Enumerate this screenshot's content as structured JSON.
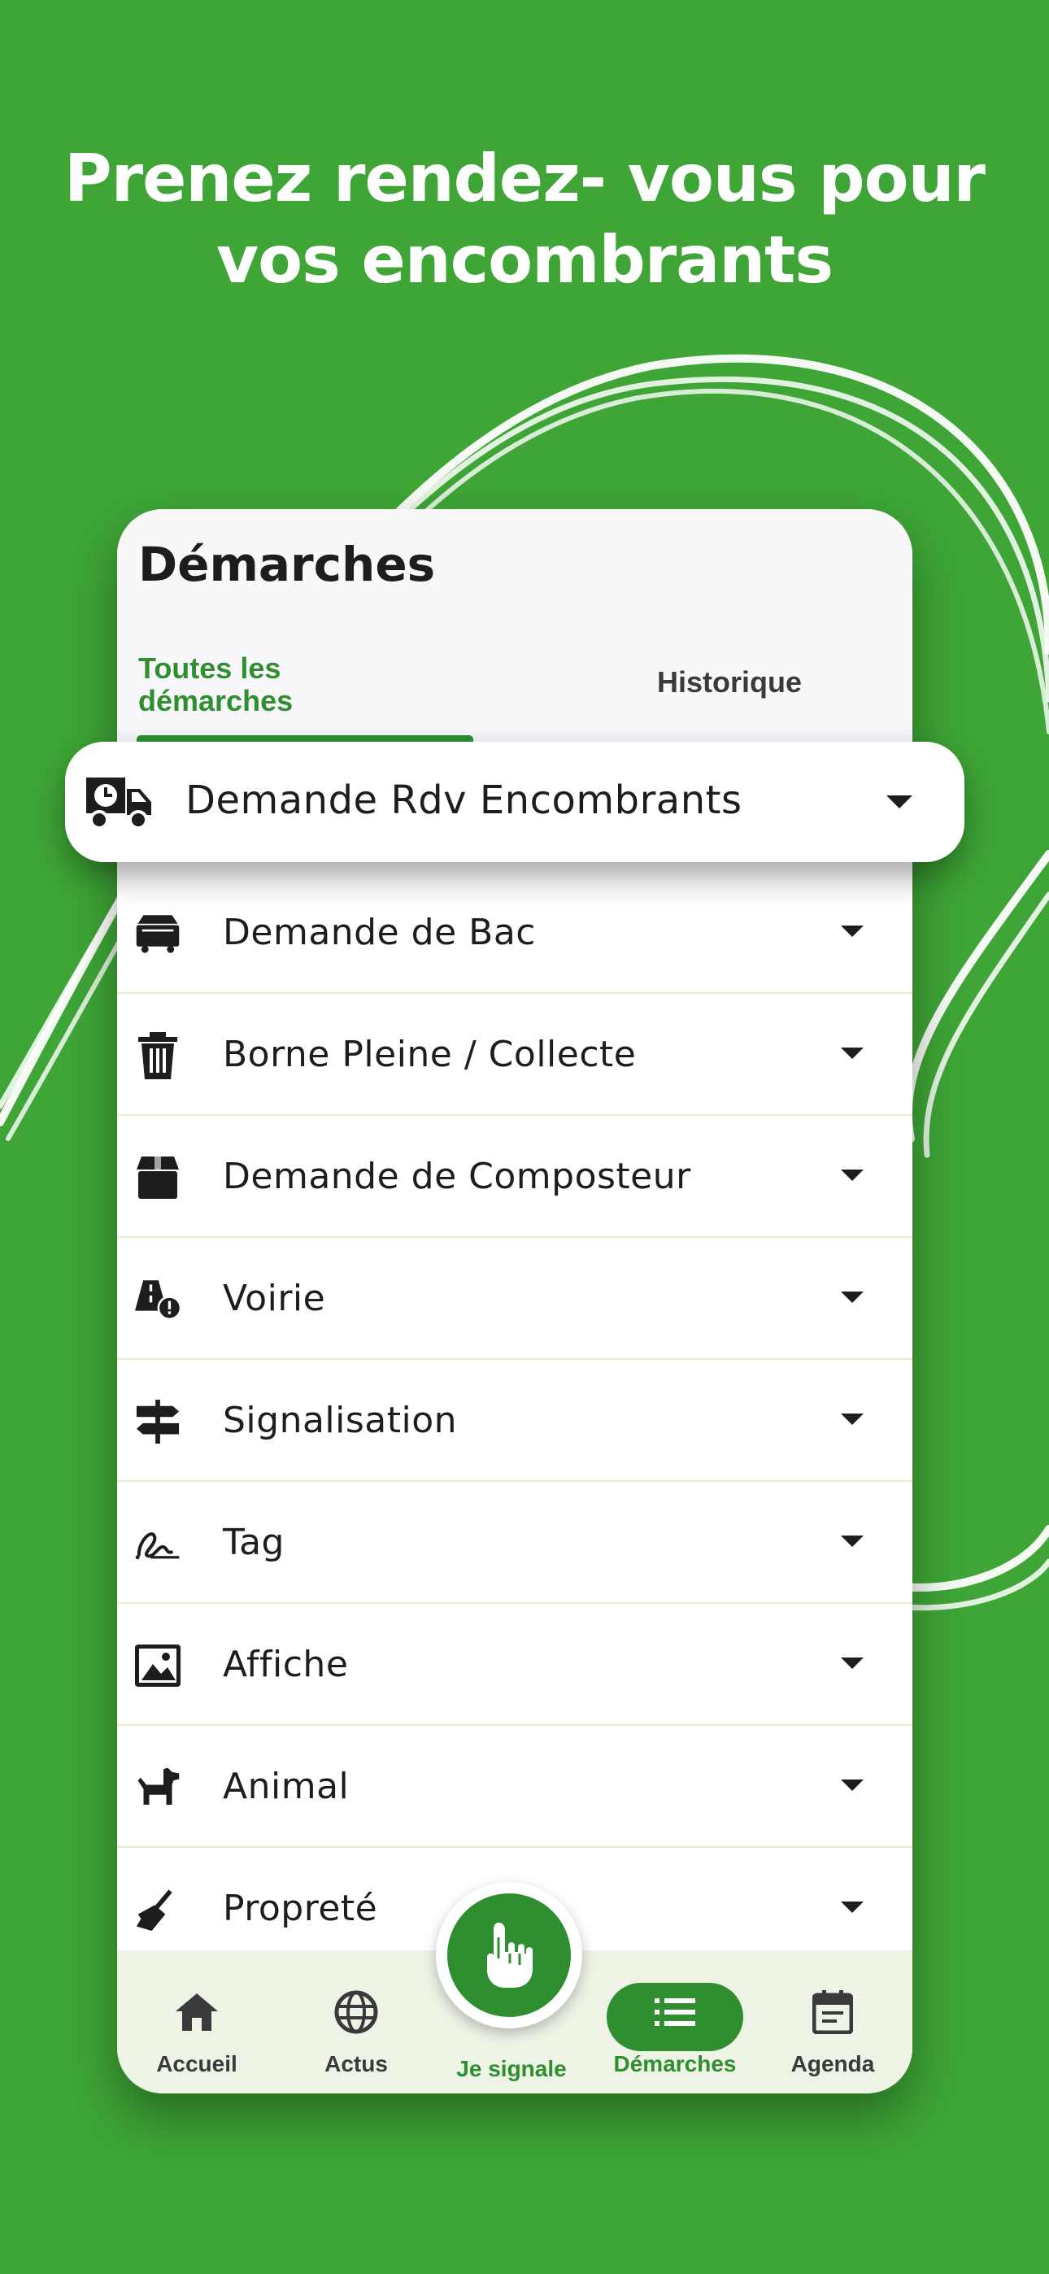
{
  "promo": {
    "headline_line1": "Prenez rendez- vous pour",
    "headline_line2": "vos encombrants"
  },
  "screen": {
    "title": "Démarches",
    "tabs": [
      {
        "label": "Toutes les démarches",
        "active": true
      },
      {
        "label": "Historique",
        "active": false
      }
    ]
  },
  "highlighted_item": {
    "label": "Demande Rdv Encombrants",
    "icon": "clock-truck-icon"
  },
  "items": [
    {
      "label": "Demande de Bac",
      "icon": "dumpster-icon"
    },
    {
      "label": "Borne Pleine / Collecte",
      "icon": "trash-icon"
    },
    {
      "label": "Demande de Composteur",
      "icon": "box-icon"
    },
    {
      "label": "Voirie",
      "icon": "road-warning-icon"
    },
    {
      "label": "Signalisation",
      "icon": "signpost-icon"
    },
    {
      "label": "Tag",
      "icon": "signature-icon"
    },
    {
      "label": "Affiche",
      "icon": "image-icon"
    },
    {
      "label": "Animal",
      "icon": "dog-icon"
    },
    {
      "label": "Propreté",
      "icon": "broom-icon"
    }
  ],
  "nav": {
    "items": [
      {
        "label": "Accueil",
        "icon": "home-icon"
      },
      {
        "label": "Actus",
        "icon": "globe-icon"
      },
      {
        "label": "Je signale",
        "icon": "hand-point-icon"
      },
      {
        "label": "Démarches",
        "icon": "list-icon",
        "active": true
      },
      {
        "label": "Agenda",
        "icon": "calendar-icon"
      }
    ]
  },
  "colors": {
    "background": "#3ea536",
    "accent": "#2f8f30",
    "nav_background": "#edf4e6"
  }
}
